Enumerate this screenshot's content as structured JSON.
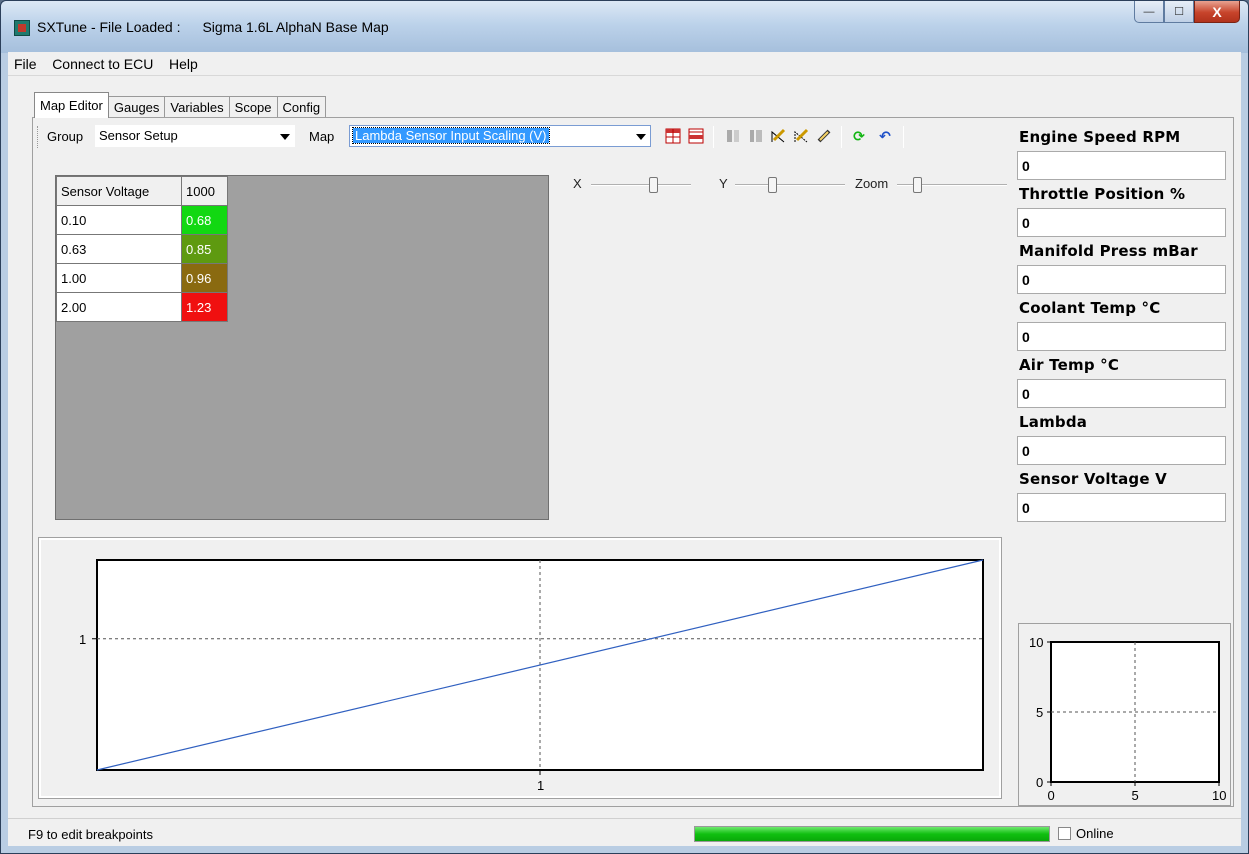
{
  "window": {
    "title": "SXTune - File Loaded :",
    "document": "Sigma 1.6L AlphaN Base Map",
    "controls": {
      "minimize": "—",
      "maximize": "☐",
      "close": "X"
    }
  },
  "menu": [
    "File",
    "Connect to ECU",
    "Help"
  ],
  "tabs": [
    "Map Editor",
    "Gauges",
    "Variables",
    "Scope",
    "Config"
  ],
  "toolbar": {
    "group_label": "Group",
    "group_value": "Sensor Setup",
    "map_label": "Map",
    "map_value": "Lambda Sensor Input Scaling (V)"
  },
  "sliders": {
    "x_label": "X",
    "y_label": "Y",
    "zoom_label": "Zoom"
  },
  "map_table": {
    "header": [
      "Sensor Voltage",
      "1000"
    ],
    "rows": [
      {
        "key": "0.10",
        "value": "0.68",
        "color": "#12d812"
      },
      {
        "key": "0.63",
        "value": "0.85",
        "color": "#5e9a10"
      },
      {
        "key": "1.00",
        "value": "0.96",
        "color": "#8a6a10"
      },
      {
        "key": "2.00",
        "value": "1.23",
        "color": "#f01010"
      }
    ]
  },
  "gauges": [
    {
      "label": "Engine Speed RPM",
      "value": "0"
    },
    {
      "label": "Throttle Position %",
      "value": "0"
    },
    {
      "label": "Manifold Press mBar",
      "value": "0"
    },
    {
      "label": "Coolant Temp °C",
      "value": "0"
    },
    {
      "label": "Air Temp °C",
      "value": "0"
    },
    {
      "label": "Lambda",
      "value": "0"
    },
    {
      "label": "Sensor Voltage V",
      "value": "0"
    }
  ],
  "chart_data": [
    {
      "type": "line",
      "xlabel": "",
      "ylabel": "",
      "x_ticks": [
        "1"
      ],
      "y_ticks": [
        "1"
      ],
      "series": [
        {
          "x": [
            0,
            1
          ],
          "y": [
            0,
            1.6
          ],
          "color": "#3060c0"
        }
      ],
      "grid": true
    },
    {
      "type": "scatter",
      "xlim": [
        0,
        10
      ],
      "ylim": [
        0,
        10
      ],
      "x_ticks": [
        "0",
        "5",
        "10"
      ],
      "y_ticks": [
        "0",
        "5",
        "10"
      ],
      "series": [],
      "grid": true
    }
  ],
  "status": {
    "hint": "F9 to edit breakpoints",
    "progress": 1.0,
    "online_label": "Online"
  }
}
